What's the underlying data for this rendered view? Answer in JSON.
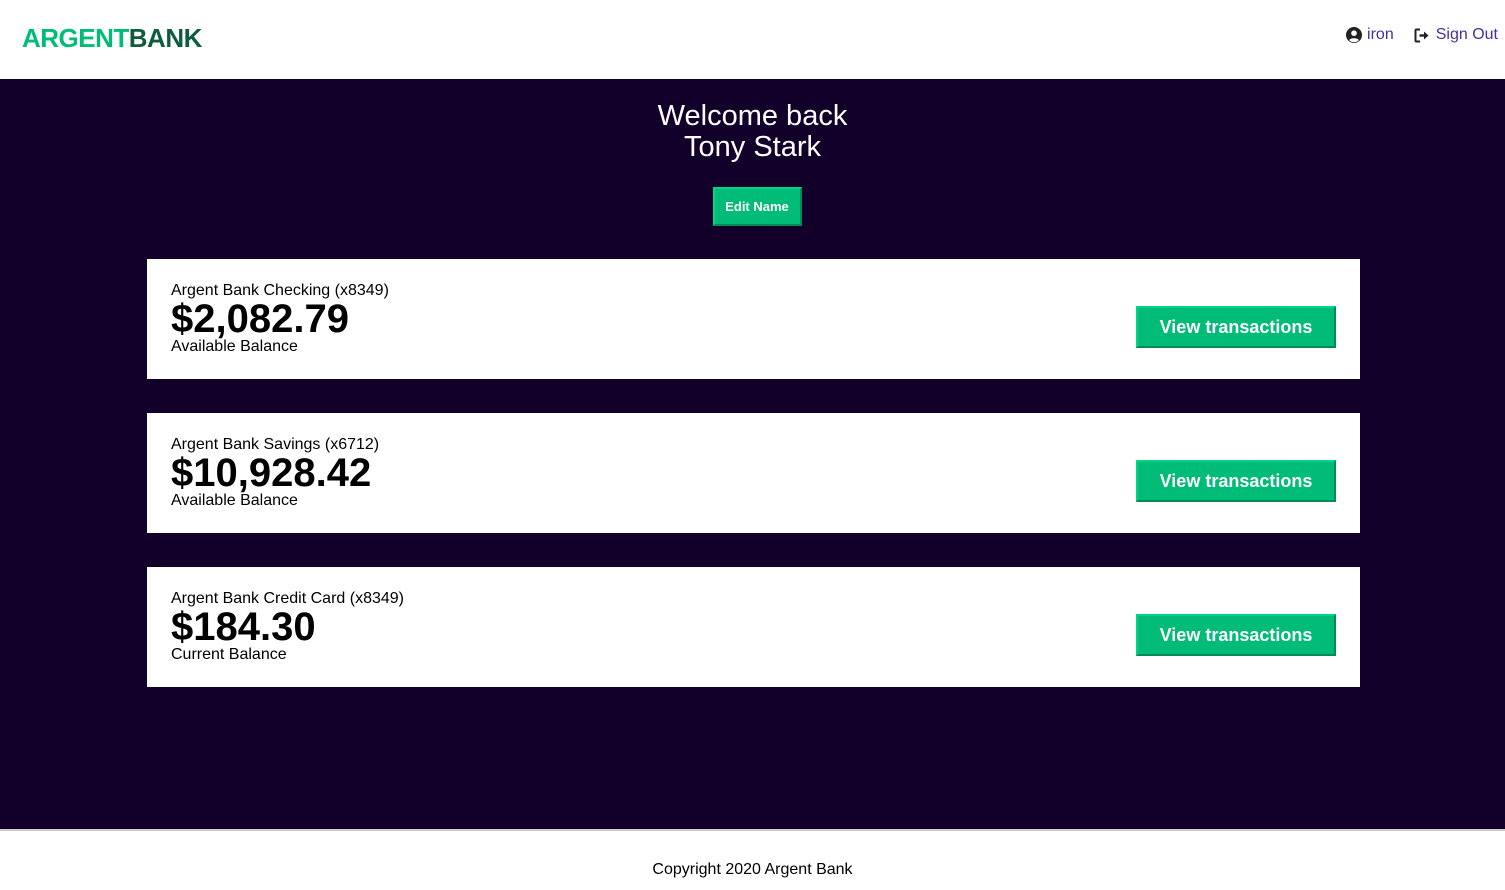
{
  "nav": {
    "logo_part1": "ARGENT",
    "logo_part2": "BANK",
    "user_icon": "user-circle-icon",
    "user_label": "iron",
    "signout_icon": "sign-out-icon",
    "signout_label": "Sign Out"
  },
  "header": {
    "line1": "Welcome back",
    "line2": "Tony Stark",
    "edit_button": "Edit Name"
  },
  "accounts": [
    {
      "title": "Argent Bank Checking (x8349)",
      "amount": "$2,082.79",
      "description": "Available Balance",
      "button": "View transactions"
    },
    {
      "title": "Argent Bank Savings (x6712)",
      "amount": "$10,928.42",
      "description": "Available Balance",
      "button": "View transactions"
    },
    {
      "title": "Argent Bank Credit Card (x8349)",
      "amount": "$184.30",
      "description": "Current Balance",
      "button": "View transactions"
    }
  ],
  "footer": {
    "copyright": "Copyright 2020 Argent Bank"
  },
  "colors": {
    "brand_green": "#00bc77",
    "logo_dark": "#0f5b3f",
    "main_bg": "#12002b",
    "link": "#4a2e9a"
  }
}
